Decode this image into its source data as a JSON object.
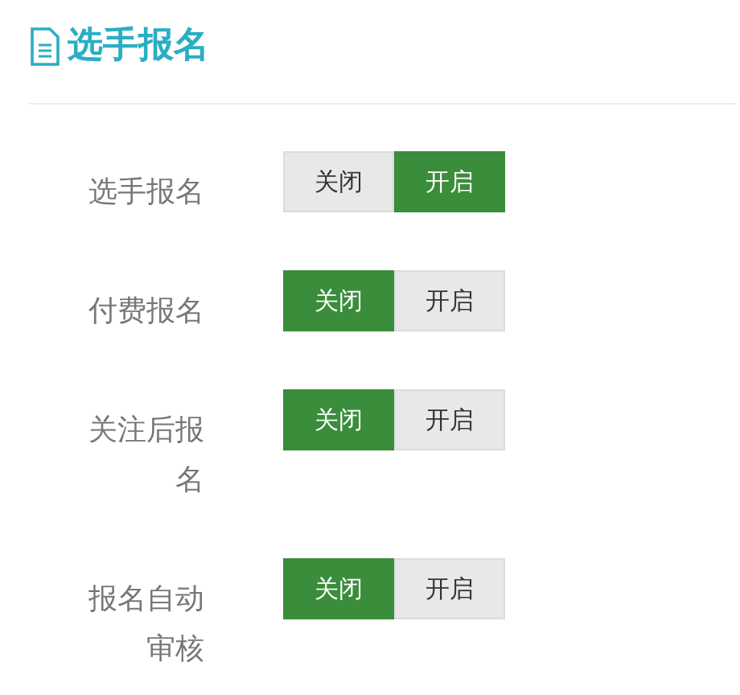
{
  "title": "选手报名",
  "settings": [
    {
      "label": "选手报名",
      "options": [
        {
          "label": "关闭",
          "selected": false
        },
        {
          "label": "开启",
          "selected": true
        }
      ]
    },
    {
      "label": "付费报名",
      "options": [
        {
          "label": "关闭",
          "selected": true
        },
        {
          "label": "开启",
          "selected": false
        }
      ]
    },
    {
      "label": "关注后报名",
      "options": [
        {
          "label": "关闭",
          "selected": true
        },
        {
          "label": "开启",
          "selected": false
        }
      ]
    },
    {
      "label": "报名自动审核",
      "options": [
        {
          "label": "关闭",
          "selected": true
        },
        {
          "label": "开启",
          "selected": false
        }
      ]
    }
  ]
}
